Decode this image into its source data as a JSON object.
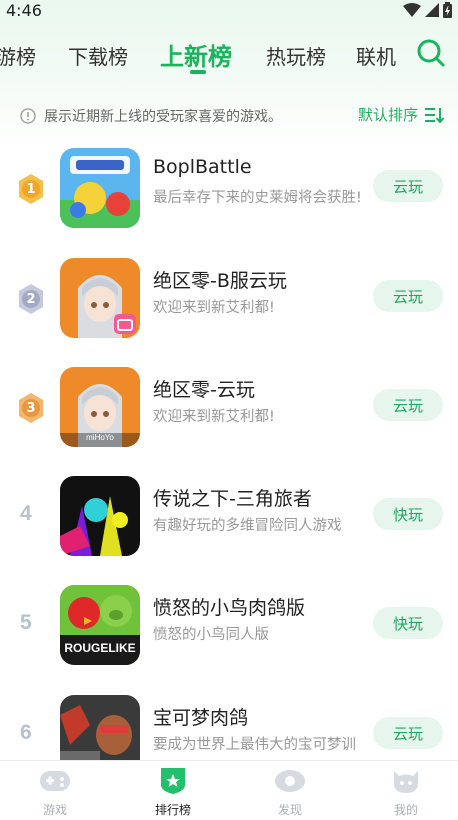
{
  "status_bar": {
    "time": "4:46"
  },
  "tabs": [
    {
      "label": "游榜"
    },
    {
      "label": "下载榜"
    },
    {
      "label": "上新榜"
    },
    {
      "label": "热玩榜"
    },
    {
      "label": "联机"
    }
  ],
  "notice": {
    "text": "展示近期新上线的受玩家喜爱的游戏。",
    "sort_label": "默认排序"
  },
  "games": [
    {
      "rank": "1",
      "title": "BoplBattle",
      "desc": "最后幸存下来的史莱姆将会获胜!",
      "action": "云玩"
    },
    {
      "rank": "2",
      "title": "绝区零-B服云玩",
      "desc": "欢迎来到新艾利都!",
      "action": "云玩"
    },
    {
      "rank": "3",
      "title": "绝区零-云玩",
      "desc": "欢迎来到新艾利都!",
      "action": "云玩",
      "icon_text": "miHoYo"
    },
    {
      "rank": "4",
      "title": "传说之下-三角旅者",
      "desc": "有趣好玩的多维冒险同人游戏",
      "action": "快玩"
    },
    {
      "rank": "5",
      "title": "愤怒的小鸟肉鸽版",
      "desc": "愤怒的小鸟同人版",
      "action": "快玩",
      "icon_text": "ROUGELIKE"
    },
    {
      "rank": "6",
      "title": "宝可梦肉鸽",
      "desc": "要成为世界上最伟大的宝可梦训练家!",
      "action": "云玩"
    }
  ],
  "bottom_nav": [
    {
      "label": "游戏"
    },
    {
      "label": "排行榜"
    },
    {
      "label": "发现"
    },
    {
      "label": "我的"
    }
  ],
  "colors": {
    "accent": "#19b45e",
    "button_bg": "#e6f6ec",
    "gold": "#f0b33a",
    "silver": "#a9b0c8",
    "bronze": "#f0a553"
  }
}
